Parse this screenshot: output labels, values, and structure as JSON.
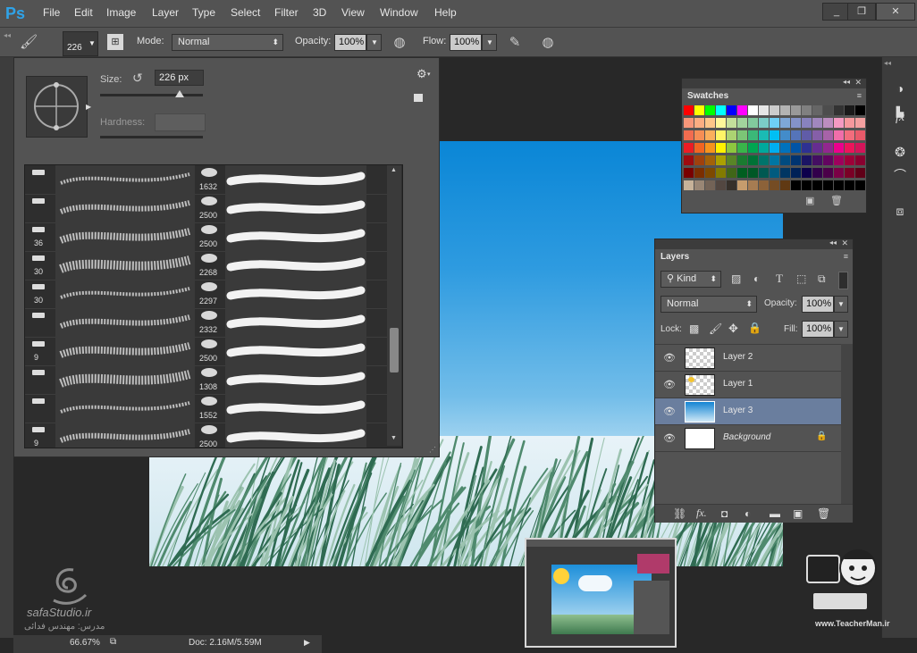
{
  "app": {
    "logo": "Ps"
  },
  "menu": [
    "File",
    "Edit",
    "Image",
    "Layer",
    "Type",
    "Select",
    "Filter",
    "3D",
    "View",
    "Window",
    "Help"
  ],
  "window_buttons": [
    "_",
    "❐",
    "✕"
  ],
  "options_bar": {
    "brush_size": "226",
    "mode_label": "Mode:",
    "mode_value": "Normal",
    "opacity_label": "Opacity:",
    "opacity_value": "100%",
    "flow_label": "Flow:",
    "flow_value": "100%"
  },
  "brush_picker": {
    "size_label": "Size:",
    "size_value": "226 px",
    "hardness_label": "Hardness:",
    "brushes": [
      {
        "left_num": "",
        "mid_num": "1632"
      },
      {
        "left_num": "",
        "mid_num": "2500"
      },
      {
        "left_num": "36",
        "mid_num": "2500"
      },
      {
        "left_num": "30",
        "mid_num": "2268"
      },
      {
        "left_num": "30",
        "mid_num": "2297"
      },
      {
        "left_num": "",
        "mid_num": "2332"
      },
      {
        "left_num": "9",
        "mid_num": "2500"
      },
      {
        "left_num": "",
        "mid_num": "1308"
      },
      {
        "left_num": "",
        "mid_num": "1552"
      },
      {
        "left_num": "9",
        "mid_num": "2500"
      }
    ]
  },
  "swatches": {
    "title": "Swatches",
    "colors": [
      [
        "#ff0000",
        "#ffff00",
        "#00ff00",
        "#00ffff",
        "#0000ff",
        "#ff00ff",
        "#ffffff",
        "#e6e6e6",
        "#cccccc",
        "#b3b3b3",
        "#999999",
        "#808080",
        "#666666",
        "#4d4d4d",
        "#333333",
        "#1a1a1a",
        "#000000"
      ],
      [
        "#f7977a",
        "#fbad82",
        "#fdc689",
        "#fff79a",
        "#c4df9b",
        "#a2d39c",
        "#82ca9d",
        "#7bcdc8",
        "#6ecff6",
        "#7ea7d8",
        "#8493ca",
        "#8882be",
        "#a187be",
        "#bc8dbf",
        "#f49ac2",
        "#f6989d",
        "#f4a0a0"
      ],
      [
        "#f26c4f",
        "#f68e55",
        "#fbaf5c",
        "#fff467",
        "#acd372",
        "#7cc576",
        "#3bb878",
        "#1abbb4",
        "#00bff3",
        "#438cca",
        "#5574b9",
        "#605ca8",
        "#855fa8",
        "#a763a8",
        "#f06eaa",
        "#f26d7d",
        "#e85a6a"
      ],
      [
        "#ed1c24",
        "#f26522",
        "#f7941d",
        "#fff200",
        "#8dc73f",
        "#39b54a",
        "#00a651",
        "#00a99d",
        "#00aeef",
        "#0072bc",
        "#0054a6",
        "#2e3192",
        "#662d91",
        "#92278f",
        "#ec008c",
        "#ed145b",
        "#d4145a"
      ],
      [
        "#9e0b0f",
        "#a0410d",
        "#a36209",
        "#aba000",
        "#598527",
        "#1a7b30",
        "#007236",
        "#00746b",
        "#0076a3",
        "#004b80",
        "#003471",
        "#1b1464",
        "#440e62",
        "#630460",
        "#9e005d",
        "#9e0039",
        "#8a0030"
      ],
      [
        "#790000",
        "#7b2e00",
        "#7d4900",
        "#827b00",
        "#406618",
        "#005e20",
        "#005826",
        "#005952",
        "#005b7f",
        "#003663",
        "#002157",
        "#0d004c",
        "#32004b",
        "#4b0049",
        "#7b0046",
        "#7a0026",
        "#600018"
      ],
      [
        "#c7b299",
        "#998675",
        "#736357",
        "#534741",
        "#37302a",
        "#c69c6d",
        "#a67c52",
        "#8c6239",
        "#754c24",
        "#603913",
        "#000000",
        "#000000",
        "#000000",
        "#000000",
        "#000000",
        "#000000",
        "#000000"
      ]
    ]
  },
  "layers_panel": {
    "title": "Layers",
    "kind_label": "Kind",
    "blend_mode": "Normal",
    "opacity_label": "Opacity:",
    "opacity_value": "100%",
    "lock_label": "Lock:",
    "fill_label": "Fill:",
    "fill_value": "100%",
    "layers": [
      {
        "name": "Layer 2",
        "selected": false
      },
      {
        "name": "Layer 1",
        "selected": false
      },
      {
        "name": "Layer 3",
        "selected": true
      },
      {
        "name": "Background",
        "selected": false
      }
    ]
  },
  "status": {
    "zoom": "66.67%",
    "doc": "Doc: 2.16M/5.59M"
  },
  "watermarks": {
    "left_brand": "safaStudio.ir",
    "left_sub": "مدرس: مهندس فدائی",
    "right_brand": "www.TeacherMan.ir"
  }
}
